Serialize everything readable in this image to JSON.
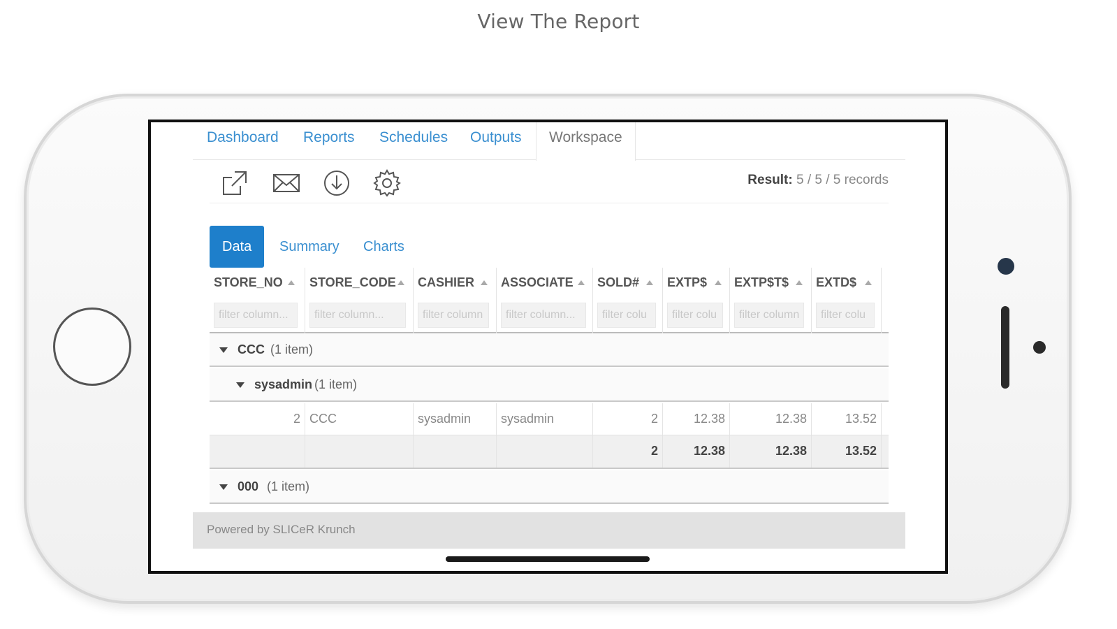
{
  "caption": "View The Report",
  "nav": {
    "items": [
      {
        "label": "Dashboard",
        "active": false
      },
      {
        "label": "Reports",
        "active": false
      },
      {
        "label": "Schedules",
        "active": false
      },
      {
        "label": "Outputs",
        "active": false
      },
      {
        "label": "Workspace",
        "active": true
      }
    ]
  },
  "toolbar": {
    "icons": [
      "external-link-icon",
      "mail-icon",
      "download-icon",
      "gear-icon"
    ],
    "result_label": "Result:",
    "result_value": "5 / 5 / 5 records"
  },
  "view_tabs": [
    {
      "label": "Data",
      "active": true
    },
    {
      "label": "Summary",
      "active": false
    },
    {
      "label": "Charts",
      "active": false
    }
  ],
  "grid": {
    "columns": [
      {
        "label": "STORE_NO",
        "filter_placeholder": "filter column..."
      },
      {
        "label": "STORE_CODE",
        "filter_placeholder": "filter column..."
      },
      {
        "label": "CASHIER",
        "filter_placeholder": "filter column"
      },
      {
        "label": "ASSOCIATE",
        "filter_placeholder": "filter column..."
      },
      {
        "label": "SOLD#",
        "filter_placeholder": "filter colu"
      },
      {
        "label": "EXTP$",
        "filter_placeholder": "filter colu"
      },
      {
        "label": "EXTP$T$",
        "filter_placeholder": "filter column"
      },
      {
        "label": "EXTD$",
        "filter_placeholder": "filter colu"
      }
    ],
    "groups": {
      "g1": {
        "name": "CCC",
        "count": "(1 item)"
      },
      "g1_sub": {
        "name": "sysadmin",
        "count": "(1 item)"
      },
      "g2": {
        "name": "000",
        "count": "(1 item)"
      }
    },
    "row": [
      "2",
      "CCC",
      "sysadmin",
      "sysadmin",
      "2",
      "12.38",
      "12.38",
      "13.52"
    ],
    "totals": [
      "",
      "",
      "",
      "",
      "2",
      "12.38",
      "12.38",
      "13.52"
    ]
  },
  "footer": "Powered by SLICeR Krunch",
  "colors": {
    "accent": "#1e7fcb",
    "link": "#3a8fd0"
  }
}
